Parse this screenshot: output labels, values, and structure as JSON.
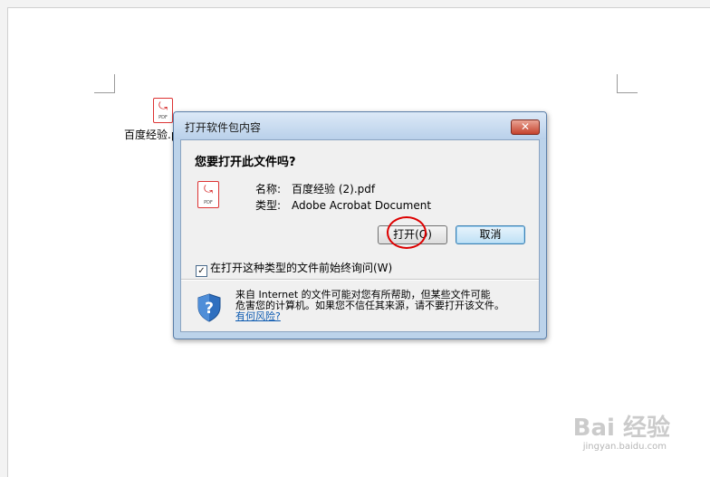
{
  "desktop": {
    "file_name": "百度经验.p",
    "file_icon_symbol": "⤿",
    "file_icon_tag": "PDF"
  },
  "dialog": {
    "title": "打开软件包内容",
    "close_symbol": "✕",
    "question": "您要打开此文件吗?",
    "file_icon_tag": "PDF",
    "name_label": "名称:",
    "name_value": "百度经验 (2).pdf",
    "type_label": "类型:",
    "type_value": "Adobe Acrobat Document",
    "open_button": "打开(O)",
    "cancel_button": "取消",
    "checkbox_label": "在打开这种类型的文件前始终询问(W)",
    "checkbox_checked": true,
    "checkbox_mark": "✓",
    "warning_line1": "来自 Internet 的文件可能对您有所帮助，但某些文件可能",
    "warning_line2": "危害您的计算机。如果您不信任其来源，请不要打开该文件。",
    "risk_link": "有何风险?"
  },
  "watermark": {
    "logo_text": "Bai 经验",
    "url": "jingyan.baidu.com"
  },
  "colors": {
    "highlight_circle": "#dd0000",
    "pdf_red": "#d32020",
    "link": "#0c5ab0"
  }
}
